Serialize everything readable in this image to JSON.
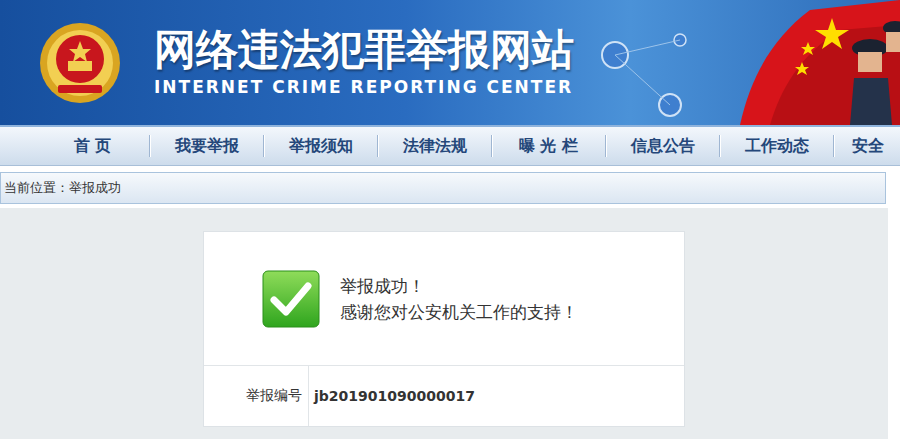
{
  "header": {
    "title": "网络违法犯罪举报网站",
    "subtitle": "INTERNET CRIME REPORTING CENTER"
  },
  "nav": {
    "items": [
      {
        "label": "首 页"
      },
      {
        "label": "我要举报"
      },
      {
        "label": "举报须知"
      },
      {
        "label": "法律法规"
      },
      {
        "label": "曝 光 栏"
      },
      {
        "label": "信息公告"
      },
      {
        "label": "工作动态"
      },
      {
        "label": "安全"
      }
    ]
  },
  "breadcrumb": "当前位置：举报成功",
  "result": {
    "title": "举报成功！",
    "message": "感谢您对公安机关工作的支持！"
  },
  "details": [
    {
      "label": "举报编号",
      "value": "jb201901090000017"
    }
  ]
}
